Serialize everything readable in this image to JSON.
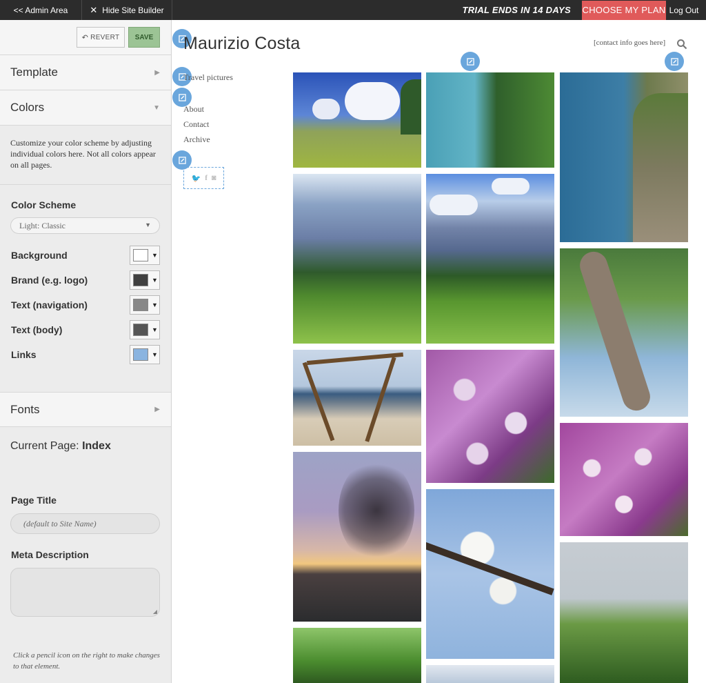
{
  "topbar": {
    "admin": "<< Admin Area",
    "hide": "Hide Site Builder",
    "trial": "TRIAL ENDS IN 14 DAYS",
    "choose": "CHOOSE MY PLAN",
    "logout": "Log Out"
  },
  "sidebar": {
    "revert": "REVERT",
    "save": "SAVE",
    "template": "Template",
    "colors": "Colors",
    "colors_desc": "Customize your color scheme by adjusting individual colors here. Not all colors appear on all pages.",
    "color_scheme_label": "Color Scheme",
    "color_scheme_value": "Light: Classic",
    "color_rows": [
      {
        "label": "Background",
        "color": "#ffffff"
      },
      {
        "label": "Brand (e.g. logo)",
        "color": "#404040"
      },
      {
        "label": "Text (navigation)",
        "color": "#888888"
      },
      {
        "label": "Text (body)",
        "color": "#555555"
      },
      {
        "label": "Links",
        "color": "#8ab4e0"
      }
    ],
    "fonts": "Fonts",
    "current_page_label": "Current Page:",
    "current_page_value": "Index",
    "page_title_label": "Page Title",
    "page_title_placeholder": "(default to Site Name)",
    "meta_label": "Meta Description",
    "hint": "Click a pencil icon on the right to make changes to that element."
  },
  "site": {
    "title": "Maurizio Costa",
    "contact": "[contact info goes here]",
    "nav_first": "Travel pictures",
    "nav": [
      "About",
      "Contact",
      "Archive"
    ]
  },
  "colors": {
    "accent": "#6aa6dc",
    "save_green": "#9cc495",
    "choose_red": "#e05a5a",
    "topbar": "#2c2c2c"
  }
}
